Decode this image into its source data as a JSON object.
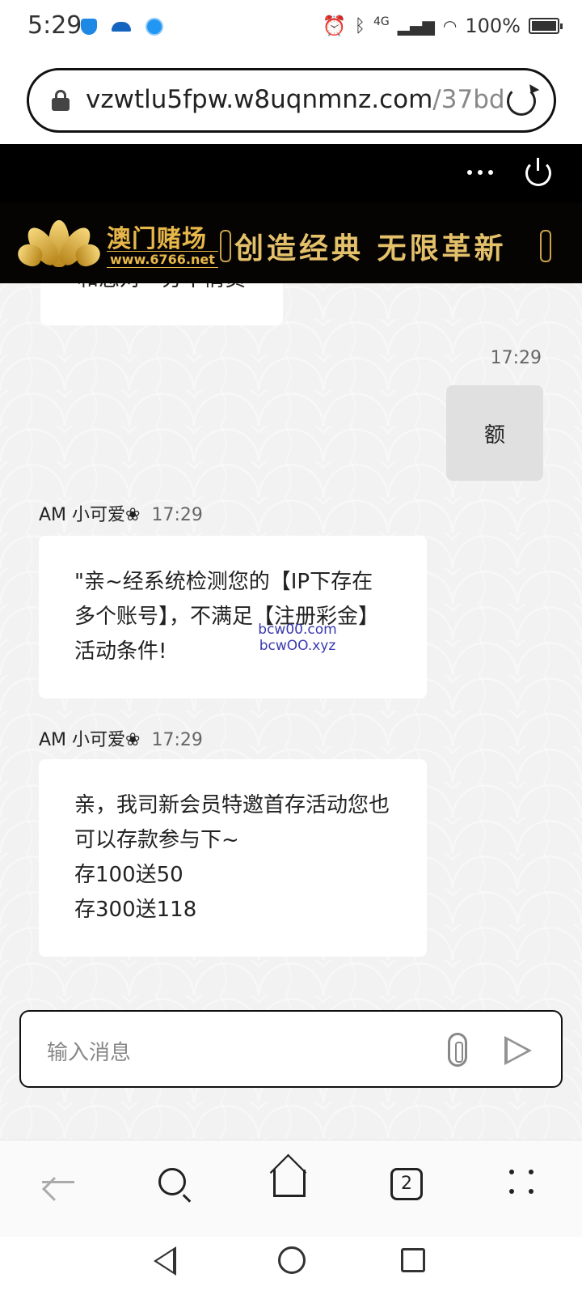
{
  "status_bar": {
    "time": "5:29",
    "network_label": "4G",
    "battery_text": "100%"
  },
  "url_bar": {
    "url_main": "vzwtlu5fpw.w8uqnmnz.com",
    "url_tail": "/37bd"
  },
  "banner": {
    "brand_name": "澳门赌场",
    "brand_url": "www.6766.net",
    "slogan": "创造经典 无限革新",
    "gold_color": "#e8b74a"
  },
  "chat": {
    "partial_message_text": "和您对一分不情员",
    "outgoing": {
      "time": "17:29",
      "text": "额"
    },
    "messages": [
      {
        "sender": "AM 小可爱❀",
        "time": "17:29",
        "text": "\"亲~经系统检测您的【IP下存在多个账号】，不满足【注册彩金】活动条件!"
      },
      {
        "sender": "AM 小可爱❀",
        "time": "17:29",
        "lines": [
          "亲，我司新会员特邀首存活动您也可以存款参与下~",
          "存100送50",
          "存300送118"
        ]
      }
    ],
    "watermark": {
      "line1": "bcw00.com",
      "line2": "bcwOO.xyz"
    }
  },
  "composer": {
    "placeholder": "输入消息"
  },
  "browser_nav": {
    "tab_count": "2"
  }
}
